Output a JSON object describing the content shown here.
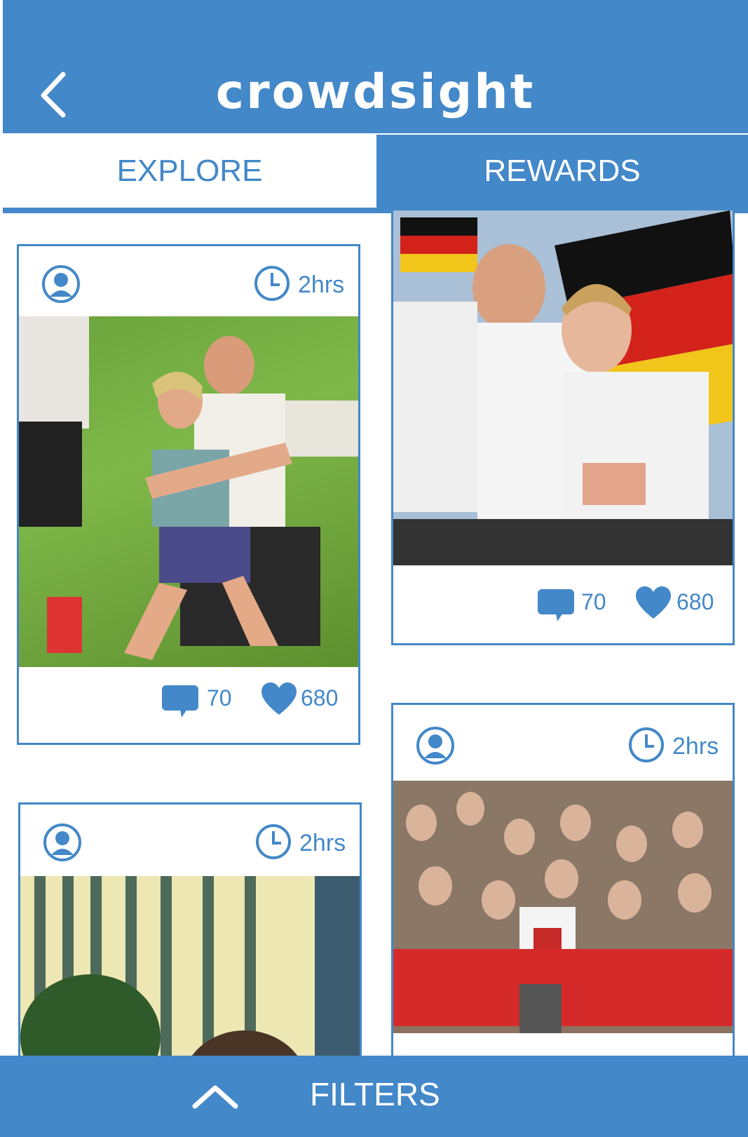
{
  "header": {
    "title": "crowdsight",
    "back_icon": "chevron-left-icon"
  },
  "tabs": [
    {
      "label": "EXPLORE",
      "active": true
    },
    {
      "label": "REWARDS",
      "active": false
    }
  ],
  "cards": [
    {
      "time": "2hrs",
      "comments": "70",
      "likes": "680",
      "photo": "women running on grass field with men"
    },
    {
      "comments": "70",
      "likes": "680",
      "photo": "skaters with German flag taking selfie"
    },
    {
      "time": "2hrs",
      "photo": "building and selfie"
    },
    {
      "time": "2hrs",
      "photo": "marathon crowd with virgin money banner"
    }
  ],
  "footer": {
    "label": "FILTERS",
    "icon": "chevron-up-icon"
  },
  "colors": {
    "brand": "#4388c8",
    "background": "#ffffff"
  }
}
